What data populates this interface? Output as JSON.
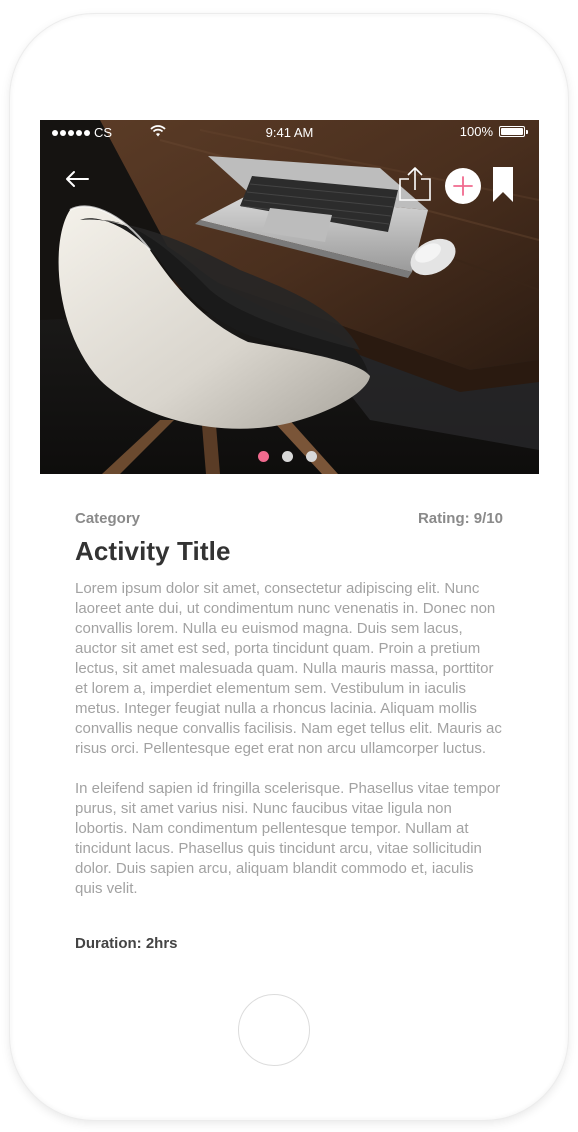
{
  "status_bar": {
    "carrier": "CS",
    "time": "9:41 AM",
    "battery": "100%"
  },
  "hero": {
    "icons": {
      "back": "back-arrow-icon",
      "share": "share-icon",
      "add": "plus-icon",
      "bookmark": "bookmark-icon"
    },
    "pager": {
      "count": 3,
      "active_index": 0,
      "active_color": "#f06a8e",
      "inactive_color": "#d8d8d8"
    }
  },
  "details": {
    "category": "Category",
    "rating": "Rating: 9/10",
    "title": "Activity Title",
    "paragraphs": [
      "Lorem ipsum dolor sit amet, consectetur adipiscing elit. Nunc laoreet ante dui, ut condimentum nunc venenatis in. Donec non convallis lorem. Nulla eu euismod magna. Duis sem lacus, auctor sit amet est sed, porta tincidunt quam. Proin a pretium lectus, sit amet malesuada quam. Nulla mauris massa, porttitor et lorem a, imperdiet elementum sem. Vestibulum in iaculis metus. Integer feugiat nulla a rhoncus lacinia. Aliquam mollis convallis neque convallis facilisis. Nam eget tellus elit. Mauris ac risus orci. Pellentesque eget erat non arcu ullamcorper luctus.",
      "In eleifend sapien id fringilla scelerisque. Phasellus vitae tempor purus, sit amet varius nisi. Nunc faucibus vitae ligula non lobortis. Nam condimentum pellentesque tempor. Nullam at tincidunt lacus. Phasellus quis tincidunt arcu, vitae sollicitudin dolor. Duis sapien arcu, aliquam blandit commodo et, iaculis quis velit."
    ],
    "duration": "Duration: 2hrs"
  },
  "colors": {
    "accent": "#f06a8e"
  }
}
